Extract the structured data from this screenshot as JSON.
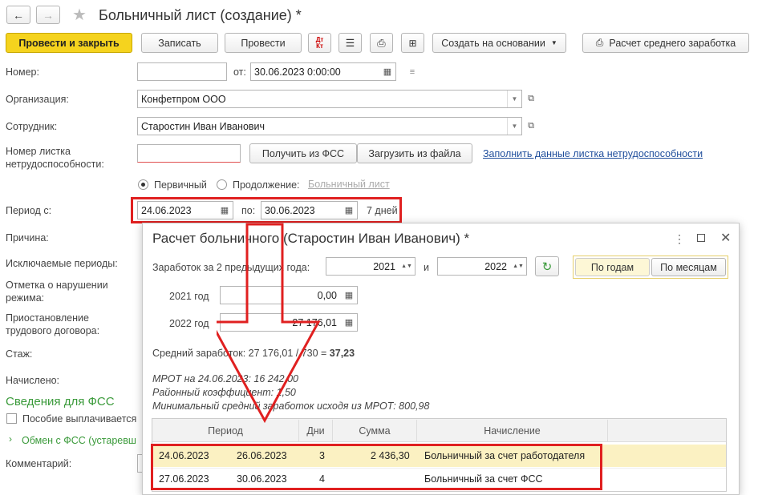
{
  "header": {
    "title": "Больничный лист (создание) *"
  },
  "toolbar": {
    "post_close": "Провести и закрыть",
    "write": "Записать",
    "post": "Провести",
    "create_based": "Создать на основании",
    "avg_earnings": "Расчет среднего заработка",
    "dt_kt": "Дт Кт"
  },
  "form": {
    "number_label": "Номер:",
    "from_label": "от:",
    "date_value": "30.06.2023  0:00:00",
    "org_label": "Организация:",
    "org_value": "Конфетпром ООО",
    "employee_label": "Сотрудник:",
    "employee_value": "Старостин Иван Иванович",
    "sheet_label_1": "Номер листка",
    "sheet_label_2": "нетрудоспособности:",
    "get_fss": "Получить из ФСС",
    "load_file": "Загрузить из файла",
    "fill_link": "Заполнить данные листка нетрудоспособности",
    "primary": "Первичный",
    "continuation": "Продолжение:",
    "sick_link": "Больничный лист",
    "period_label": "Период с:",
    "period_from": "24.06.2023",
    "period_to_label": "по:",
    "period_to": "30.06.2023",
    "days": "7 дней",
    "reason_label": "Причина:",
    "excluded_label": "Исключаемые периоды:",
    "violation_1": "Отметка о нарушении",
    "violation_2": "режима:",
    "suspend_1": "Приостановление",
    "suspend_2": "трудового договора:",
    "exp_label": "Стаж:",
    "accrued_label": "Начислено:",
    "fss_header": "Сведения для ФСС",
    "benefit_cb": "Пособие выплачивается",
    "exchange": "Обмен с ФСС (устаревш",
    "comment_label": "Комментарий:"
  },
  "dialog": {
    "title": "Расчет больничного (Старостин Иван Иванович) *",
    "earnings_label": "Заработок за 2 предыдущих года:",
    "year1": "2021",
    "and_label": "и",
    "year2": "2022",
    "by_years": "По годам",
    "by_months": "По месяцам",
    "y2021_label": "2021 год",
    "y2021_value": "0,00",
    "y2022_label": "2022 год",
    "y2022_value": "27 176,01",
    "avg_text": "Средний заработок: 27 176,01 / 730 = ",
    "avg_result": "37,23",
    "mrot": "МРОТ на 24.06.2023: 16 242,00",
    "coef": "Районный коэффициент: 1,50",
    "min_avg": "Минимальный средний заработок исходя из МРОТ: 800,98",
    "table": {
      "headers": [
        "Период",
        "Дни",
        "Сумма",
        "Начисление"
      ],
      "rows": [
        {
          "from": "24.06.2023",
          "to": "26.06.2023",
          "days": "3",
          "sum": "2 436,30",
          "accrual": "Больничный за счет работодателя"
        },
        {
          "from": "27.06.2023",
          "to": "30.06.2023",
          "days": "4",
          "sum": "",
          "accrual": "Больничный за счет ФСС"
        }
      ]
    }
  }
}
